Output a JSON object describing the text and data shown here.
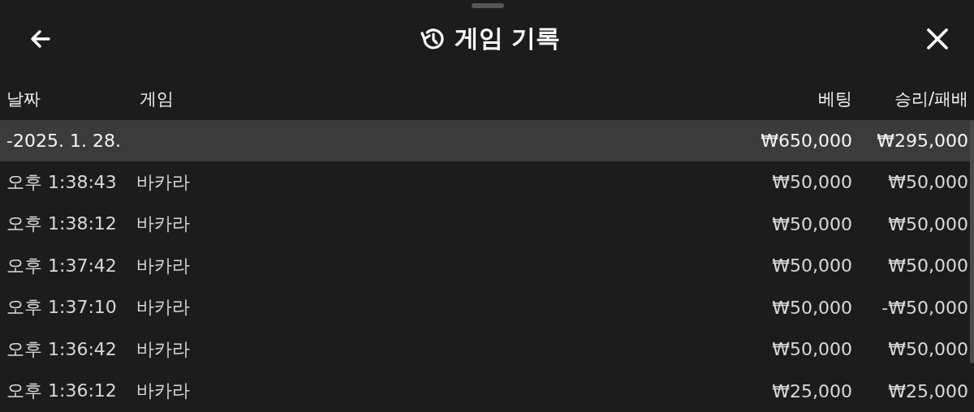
{
  "header": {
    "title": "게임 기록"
  },
  "table": {
    "columns": [
      "날짜",
      "게임",
      "베팅",
      "승리/패배"
    ],
    "groups": [
      {
        "date": "-2025. 1. 28.",
        "bet_total": "₩650,000",
        "result_total": "₩295,000",
        "expanded": true,
        "rows": [
          {
            "time": "오후 1:38:43",
            "game": "바카라",
            "bet": "₩50,000",
            "result": "₩50,000"
          },
          {
            "time": "오후 1:38:12",
            "game": "바카라",
            "bet": "₩50,000",
            "result": "₩50,000"
          },
          {
            "time": "오후 1:37:42",
            "game": "바카라",
            "bet": "₩50,000",
            "result": "₩50,000"
          },
          {
            "time": "오후 1:37:10",
            "game": "바카라",
            "bet": "₩50,000",
            "result": "-₩50,000"
          },
          {
            "time": "오후 1:36:42",
            "game": "바카라",
            "bet": "₩50,000",
            "result": "₩50,000"
          },
          {
            "time": "오후 1:36:12",
            "game": "바카라",
            "bet": "₩25,000",
            "result": "₩25,000"
          }
        ]
      }
    ]
  }
}
